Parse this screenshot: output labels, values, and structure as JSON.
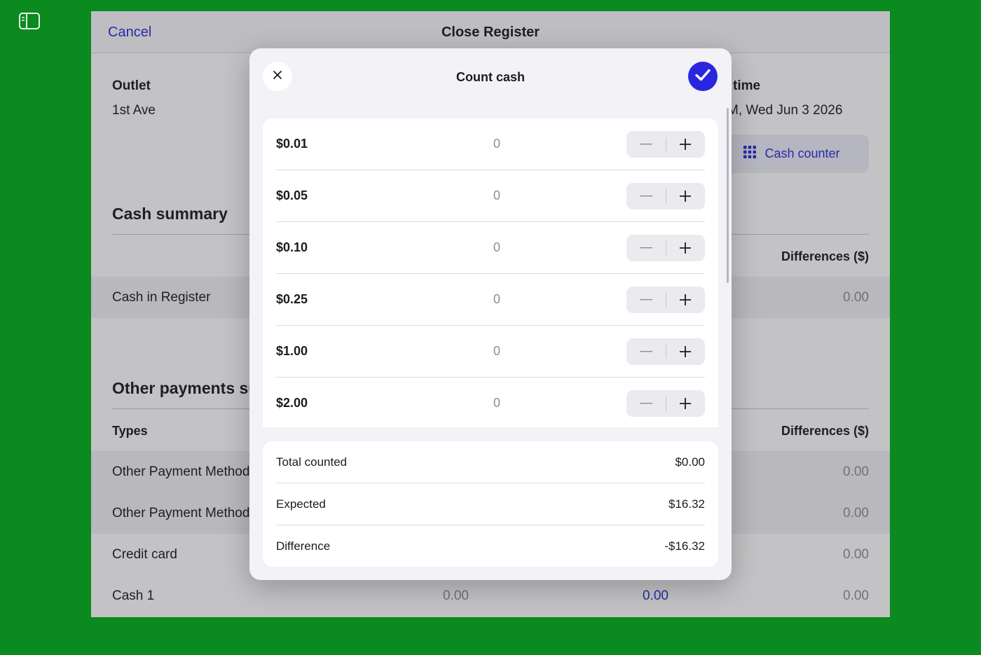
{
  "sheet": {
    "cancel_label": "Cancel",
    "title": "Close Register",
    "outlet_label": "Outlet",
    "outlet_value": "1st Ave",
    "time_label_partial": "time",
    "time_value_partial": "M, Wed Jun 3 2026",
    "cash_counter_label": "Cash counter",
    "cash_summary_title": "Cash summary",
    "cash_summary_diff_header": "Differences ($)",
    "cash_in_register_label": "Cash in Register",
    "cash_in_register_diff": "0.00",
    "other_payments_title": "Other payments su",
    "types_header": "Types",
    "other_diff_header": "Differences ($)",
    "rows": [
      {
        "label": "Other Payment Method",
        "diff": "0.00"
      },
      {
        "label": "Other Payment Method",
        "diff": "0.00"
      },
      {
        "label": "Credit card",
        "diff": "0.00"
      },
      {
        "label": "Cash 1",
        "expected": "0.00",
        "counted": "0.00",
        "diff": "0.00"
      }
    ]
  },
  "modal": {
    "title": "Count cash",
    "close_icon": "close-icon",
    "confirm_icon": "checkmark-icon",
    "denominations": [
      {
        "label": "$0.01",
        "qty": "0"
      },
      {
        "label": "$0.05",
        "qty": "0"
      },
      {
        "label": "$0.10",
        "qty": "0"
      },
      {
        "label": "$0.25",
        "qty": "0"
      },
      {
        "label": "$1.00",
        "qty": "0"
      },
      {
        "label": "$2.00",
        "qty": "0"
      }
    ],
    "totals": {
      "total_counted_label": "Total counted",
      "total_counted_value": "$0.00",
      "expected_label": "Expected",
      "expected_value": "$16.32",
      "difference_label": "Difference",
      "difference_value": "-$16.32"
    }
  },
  "colors": {
    "background": "#0b8a1f",
    "accent": "#2a26e0",
    "link": "#2a2ad6"
  }
}
